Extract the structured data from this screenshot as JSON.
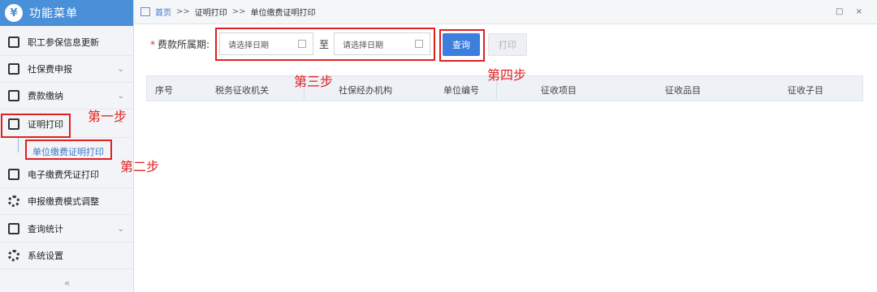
{
  "sidebar": {
    "title": "功能菜单",
    "logo": "¥",
    "items": [
      {
        "label": "职工参保信息更新"
      },
      {
        "label": "社保费申报",
        "chevron": "⌄"
      },
      {
        "label": "费款缴纳",
        "chevron": "⌄"
      },
      {
        "label": "证明打印",
        "chevron": "⌃"
      },
      {
        "label": "电子缴费凭证打印"
      },
      {
        "label": "申报缴费模式调整"
      },
      {
        "label": "查询统计",
        "chevron": "⌄"
      },
      {
        "label": "系统设置"
      }
    ],
    "submenu": {
      "label": "单位缴费证明打印"
    },
    "collapse": "«"
  },
  "breadcrumb": {
    "home": "首页",
    "sep": ">>",
    "items": [
      "证明打印",
      "单位缴费证明打印"
    ],
    "win_icons": "□ ×"
  },
  "filter": {
    "required_mark": "*",
    "label": "费款所属期:",
    "start_placeholder": "请选择日期",
    "to": "至",
    "end_placeholder": "请选择日期",
    "query_label": "查询",
    "print_label": "打印"
  },
  "table": {
    "columns": [
      "序号",
      "税务征收机关",
      "社保经办机构",
      "单位编号",
      "征收项目",
      "征收品目",
      "征收子目"
    ]
  },
  "annotations": {
    "step1": "第一步",
    "step2": "第二步",
    "step3": "第三步",
    "step4": "第四步",
    "color": "#e02020"
  }
}
